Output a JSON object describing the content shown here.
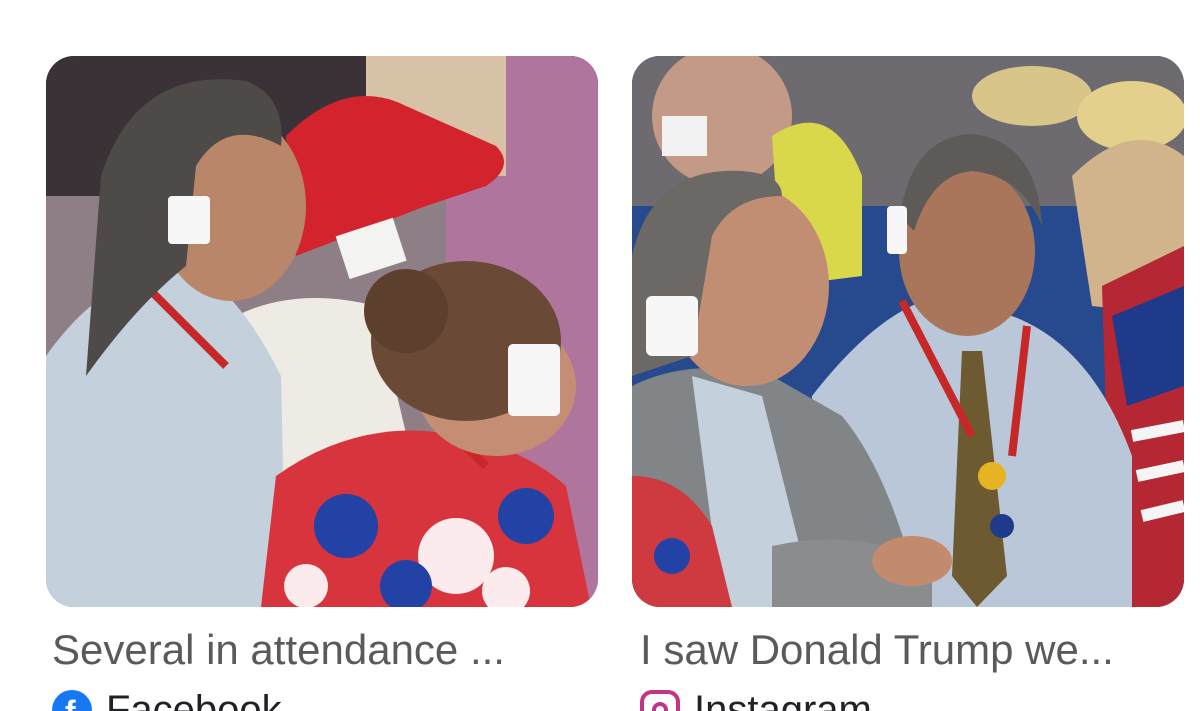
{
  "results": [
    {
      "caption": "Several in attendance ...",
      "source": "Facebook",
      "source_icon": "facebook-icon",
      "image_alt": "Delegates wearing white gauze bandages over their right ears at a convention"
    },
    {
      "caption": "I saw Donald Trump we...",
      "source": "Instagram",
      "source_icon": "instagram-icon",
      "image_alt": "Two men in the convention crowd, one with a white ear bandage"
    }
  ],
  "colors": {
    "caption_text": "#5a5a5a",
    "facebook_blue": "#1877f2",
    "instagram_pink": "#c13584",
    "lanyard_red": "#c62828"
  }
}
